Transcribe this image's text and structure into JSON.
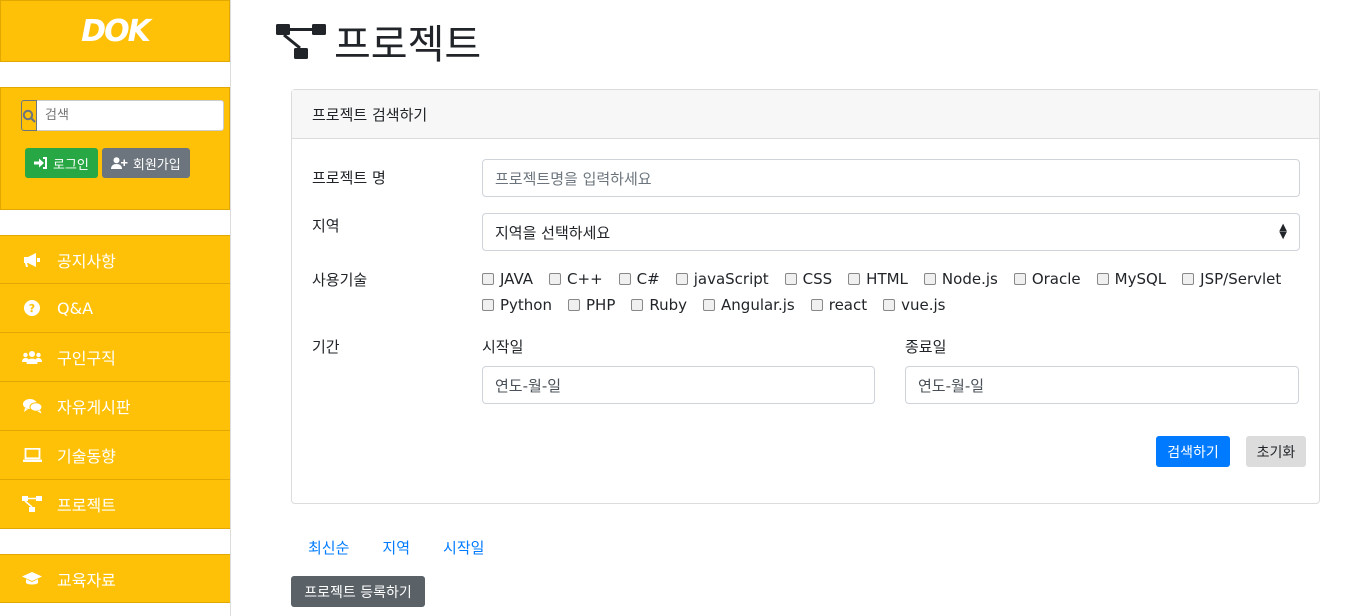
{
  "sidebar": {
    "logo": "DOK",
    "search": {
      "placeholder": "검색"
    },
    "login_label": "로그인",
    "join_label": "회원가입",
    "nav_primary": [
      {
        "label": "공지사항",
        "icon": "megaphone-icon"
      },
      {
        "label": "Q&A",
        "icon": "question-circle-icon"
      },
      {
        "label": "구인구직",
        "icon": "users-icon"
      },
      {
        "label": "자유게시판",
        "icon": "comments-icon"
      },
      {
        "label": "기술동향",
        "icon": "laptop-icon"
      },
      {
        "label": "프로젝트",
        "icon": "sitemap-icon"
      }
    ],
    "nav_secondary": [
      {
        "label": "교육자료",
        "icon": "graduation-cap-icon"
      }
    ]
  },
  "page": {
    "title": "프로젝트"
  },
  "search_card": {
    "header": "프로젝트 검색하기",
    "name_label": "프로젝트 명",
    "name_placeholder": "프로젝트명을 입력하세요",
    "region_label": "지역",
    "region_selected": "지역을 선택하세요",
    "tech_label": "사용기술",
    "techs": [
      "JAVA",
      "C++",
      "C#",
      "javaScript",
      "CSS",
      "HTML",
      "Node.js",
      "Oracle",
      "MySQL",
      "JSP/Servlet",
      "Python",
      "PHP",
      "Ruby",
      "Angular.js",
      "react",
      "vue.js"
    ],
    "period_label": "기간",
    "start_label": "시작일",
    "start_value": "연도-월-일",
    "end_label": "종료일",
    "end_value": "연도-월-일",
    "search_button": "검색하기",
    "reset_button": "초기화"
  },
  "sort": {
    "latest": "최신순",
    "region": "지역",
    "start": "시작일"
  },
  "register_button": "프로젝트 등록하기",
  "colors": {
    "sidebar": "#ffc107",
    "primary": "#007bff",
    "success": "#28a745",
    "secondary": "#6c757d"
  }
}
